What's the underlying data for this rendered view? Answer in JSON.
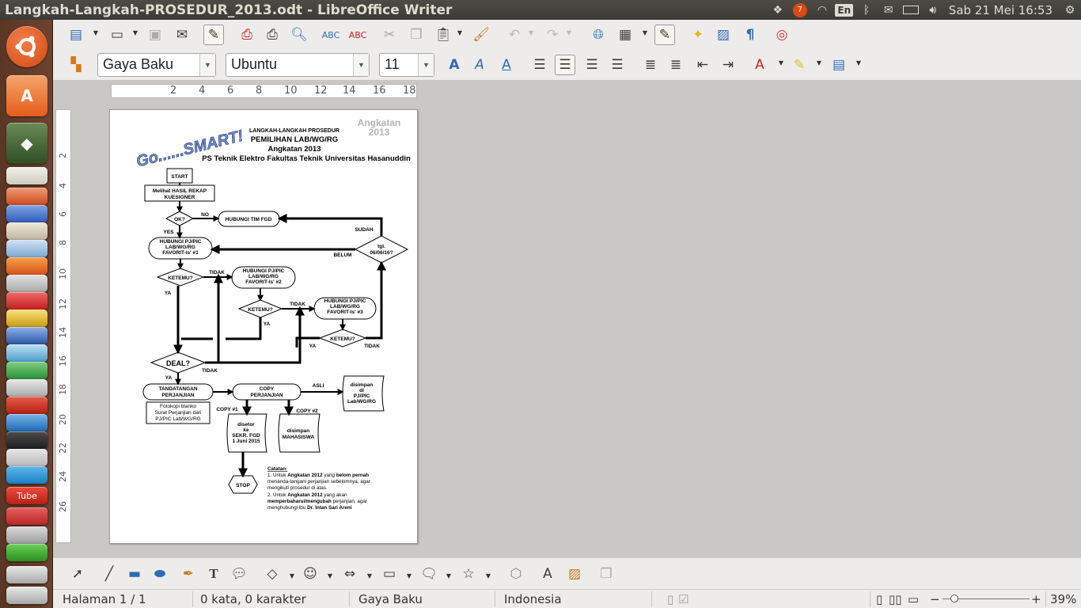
{
  "window": {
    "title": "Langkah-Langkah-PROSEDUR_2013.odt - LibreOffice Writer"
  },
  "panel": {
    "keyboard": "En",
    "mail_badge": "7",
    "clock": "Sab 21 Mei 16:53"
  },
  "formatting": {
    "paragraph_style": "Gaya Baku",
    "font_name": "Ubuntu",
    "font_size": "11"
  },
  "ruler": {
    "h_ticks": [
      "2",
      "4",
      "6",
      "8",
      "10",
      "12",
      "14",
      "16",
      "18"
    ],
    "v_ticks": [
      "2",
      "4",
      "6",
      "8",
      "10",
      "12",
      "14",
      "16",
      "18",
      "20",
      "22",
      "24",
      "26"
    ]
  },
  "status": {
    "page": "Halaman 1 / 1",
    "words": "0 kata, 0 karakter",
    "style": "Gaya Baku",
    "language": "Indonesia",
    "zoom": "39%"
  },
  "launcher": {
    "youtube_label": "Tube"
  },
  "document": {
    "logo_text": "Go......SMART!",
    "badge": [
      "Angkatan",
      "2013"
    ],
    "title_1": "LANGKAH-LANGKAH PROSEDUR",
    "title_2": "PEMILIHAN LAB/WG/RG",
    "title_3": "Angkatan 2013",
    "title_4": "PS Teknik Elektro Fakultas Teknik Universitas Hasanuddin",
    "nodes": {
      "start": "START",
      "rekap": [
        "Melihat HASIL REKAP",
        "KUESIONER"
      ],
      "ok": "OK?",
      "no": "NO",
      "hub_fgd": "HUBUNGI TIM FGD",
      "sudah": "SUDAH",
      "tgl": [
        "tgl.",
        "06/06/16?"
      ],
      "belum": "BELUM",
      "yes": "YES",
      "hub1": [
        "HUBUNGI PJ/PIC",
        "LAB/WG/RG",
        "FAVORIT-ls' #1"
      ],
      "ketemu1": "KETEMU?",
      "tidak1": "TIDAK",
      "hub2": [
        "HUBUNGI PJ/PIC",
        "LAB/WG/RG",
        "FAVORIT-ls' #2"
      ],
      "ketemu2": "KETEMU?",
      "tidak2": "TIDAK",
      "hub3": [
        "HUBUNGI PJ/PIC",
        "LAB/WG/RG",
        "FAVORIT-ls' #3"
      ],
      "ketemu3": "KETEMU?",
      "tidak3": "TIDAK",
      "ya1": "YA",
      "ya2": "YA",
      "ya3": "YA",
      "deal": "DEAL?",
      "ya_deal": "YA",
      "tidak_deal": "TIDAK",
      "ttd": [
        "TANDATANGAN",
        "PERJANJIAN"
      ],
      "fotokopi": [
        "Fotokopi blanko",
        "Surat Perjanjian dari",
        "PJ/PIC Lab/WG/RG"
      ],
      "copy": [
        "COPY",
        "PERJANJIAN"
      ],
      "asli": "ASLI",
      "simpan_lab": [
        "disimpan",
        "di",
        "PJ/PIC",
        "Lab/WG/RG"
      ],
      "copy1": "COPY #1",
      "copy2": "COPY #2",
      "setor": [
        "disetor",
        "ke",
        "SEKR. FGD",
        "1 Juni 2015"
      ],
      "simpan_mhs": [
        "disimpan",
        "MAHASISWA"
      ],
      "stop": "STOP"
    },
    "notes": {
      "head": "Catatan:",
      "n1a": "1. Untuk ",
      "n1b": "Angkatan 2012",
      "n1c": " yang ",
      "n1d": "belom pernah",
      "n1e": "menanda-tangani perjanjian sebelomnya, agar",
      "n1f": "mengikuti prosedur di atas.",
      "n2a": "2. Untuk ",
      "n2b": "Angkatan 2012",
      "n2c": " yang akan",
      "n2d": "memperbaharui/mengubah",
      "n2e": " perjanjian, agar",
      "n2f": "menghubungi ibu ",
      "n2g": "Dr. Intan Sari Areni"
    }
  }
}
